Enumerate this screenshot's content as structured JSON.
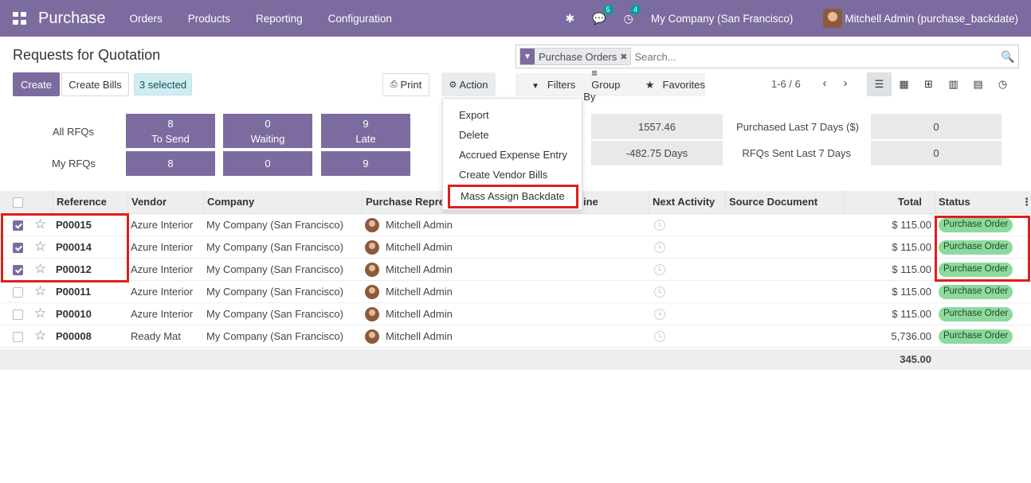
{
  "navbar": {
    "app_name": "Purchase",
    "menu": [
      "Orders",
      "Products",
      "Reporting",
      "Configuration"
    ],
    "discuss_count": "5",
    "activity_count": "4",
    "company": "My Company (San Francisco)",
    "user": "Mitchell Admin (purchase_backdate)"
  },
  "page": {
    "title": "Requests for Quotation",
    "create_label": "Create",
    "create_bills_label": "Create Bills",
    "selected_label": "3 selected",
    "print_label": "Print",
    "action_label": "Action"
  },
  "search": {
    "facet": "Purchase Orders",
    "placeholder": "Search...",
    "filters_label": "Filters",
    "group_by_label": "Group By",
    "favorites_label": "Favorites"
  },
  "pager": {
    "value": "1-6 / 6"
  },
  "action_menu": [
    "Export",
    "Delete",
    "Accrued Expense Entry",
    "Create Vendor Bills",
    "Mass Assign Backdate"
  ],
  "dashboard": {
    "all_rfqs_label": "All RFQs",
    "my_rfqs_label": "My RFQs",
    "tiles": {
      "to_send": {
        "value": "8",
        "label": "To Send"
      },
      "waiting": {
        "value": "0",
        "label": "Waiting"
      },
      "late": {
        "value": "9",
        "label": "Late"
      }
    },
    "my": {
      "to_send": "8",
      "waiting": "0",
      "late": "9"
    },
    "stats": {
      "value_1": "1557.46",
      "value_2": "-482.75  Days",
      "purchased_label": "Purchased Last 7 Days ($)",
      "purchased_value": "0",
      "sent_label": "RFQs Sent Last 7 Days",
      "sent_value": "0"
    }
  },
  "table": {
    "columns": {
      "reference": "Reference",
      "vendor": "Vendor",
      "company": "Company",
      "representative": "Purchase Repre",
      "deadline": "ine",
      "next_activity": "Next Activity",
      "source_document": "Source Document",
      "total": "Total",
      "status": "Status"
    },
    "rows": [
      {
        "checked": true,
        "ref": "P00015",
        "vendor": "Azure Interior",
        "company": "My Company (San Francisco)",
        "rep": "Mitchell Admin",
        "total": "$ 115.00",
        "status": "Purchase Order"
      },
      {
        "checked": true,
        "ref": "P00014",
        "vendor": "Azure Interior",
        "company": "My Company (San Francisco)",
        "rep": "Mitchell Admin",
        "total": "$ 115.00",
        "status": "Purchase Order"
      },
      {
        "checked": true,
        "ref": "P00012",
        "vendor": "Azure Interior",
        "company": "My Company (San Francisco)",
        "rep": "Mitchell Admin",
        "total": "$ 115.00",
        "status": "Purchase Order"
      },
      {
        "checked": false,
        "ref": "P00011",
        "vendor": "Azure Interior",
        "company": "My Company (San Francisco)",
        "rep": "Mitchell Admin",
        "total": "$ 115.00",
        "status": "Purchase Order"
      },
      {
        "checked": false,
        "ref": "P00010",
        "vendor": "Azure Interior",
        "company": "My Company (San Francisco)",
        "rep": "Mitchell Admin",
        "total": "$ 115.00",
        "status": "Purchase Order"
      },
      {
        "checked": false,
        "ref": "P00008",
        "vendor": "Ready Mat",
        "company": "My Company (San Francisco)",
        "rep": "Mitchell Admin",
        "total": "5,736.00",
        "status": "Purchase Order"
      }
    ],
    "footer_total": "345.00"
  },
  "colors": {
    "brand": "#7c6b9f",
    "highlight": "#e21d1d",
    "status_badge": "#8ed99e"
  }
}
